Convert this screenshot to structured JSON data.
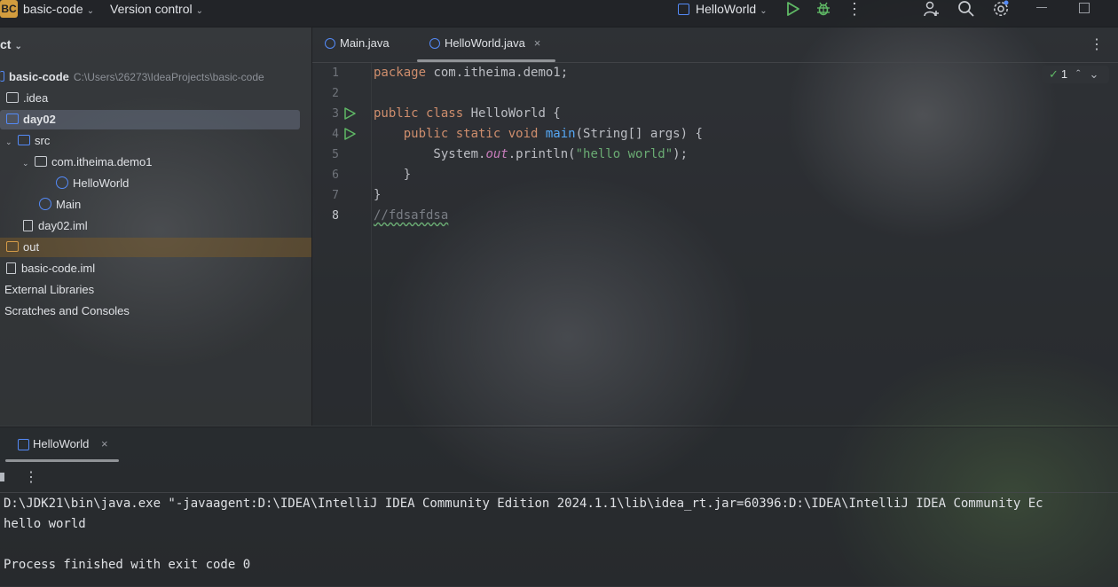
{
  "titlebar": {
    "project_badge": "BC",
    "project_name": "basic-code",
    "version_control": "Version control",
    "run_config": "HelloWorld"
  },
  "project_panel": {
    "title": "ct",
    "items": [
      {
        "label": "basic-code",
        "hint": "C:\\Users\\26273\\IdeaProjects\\basic-code"
      },
      {
        "label": ".idea"
      },
      {
        "label": "day02"
      },
      {
        "label": "src"
      },
      {
        "label": "com.itheima.demo1"
      },
      {
        "label": "HelloWorld"
      },
      {
        "label": "Main"
      },
      {
        "label": "day02.iml"
      },
      {
        "label": "out"
      },
      {
        "label": "basic-code.iml"
      },
      {
        "label": "External Libraries"
      },
      {
        "label": "Scratches and Consoles"
      }
    ]
  },
  "editor": {
    "tabs": [
      {
        "label": "Main.java"
      },
      {
        "label": "HelloWorld.java",
        "active": true
      }
    ],
    "line_numbers": [
      "1",
      "2",
      "3",
      "4",
      "5",
      "6",
      "7",
      "8"
    ],
    "code": {
      "l1_kw": "package",
      "l1_rest": " com.itheima.demo1;",
      "l3_kw": "public class",
      "l3_rest": " HelloWorld {",
      "l4_indent": "    ",
      "l4_kw": "public static void",
      "l4_fn": "main",
      "l4_rest": "(String[] args) {",
      "l5_pre": "        System.",
      "l5_out": "out",
      "l5_mid": ".println(",
      "l5_str": "\"hello world\"",
      "l5_end": ");",
      "l6": "    }",
      "l7": "}",
      "l8": "//fdsafdsa"
    },
    "inspection_count": "1"
  },
  "run_panel": {
    "tab_label": "HelloWorld",
    "console_lines": [
      "D:\\JDK21\\bin\\java.exe \"-javaagent:D:\\IDEA\\IntelliJ IDEA Community Edition 2024.1.1\\lib\\idea_rt.jar=60396:D:\\IDEA\\IntelliJ IDEA Community Ec",
      "hello world",
      "",
      "Process finished with exit code 0"
    ]
  },
  "colors": {
    "accent_blue": "#548af7",
    "keyword": "#cf8e6d",
    "string": "#6aab73",
    "function": "#56a8f5",
    "run_green": "#5fb865",
    "badge_orange": "#d29c3e"
  }
}
